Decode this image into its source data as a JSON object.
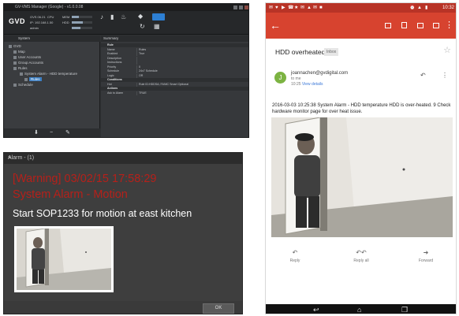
{
  "vms": {
    "title": "GV-VMS Manager (Google) - v1.0.0.08",
    "logo": "GVD",
    "stats": [
      "GVS 06.21",
      "CPU",
      "IP: 192.168.1.50",
      "MEM",
      "admin",
      "HDD"
    ],
    "left_header": "System",
    "tree": [
      "Map",
      "User Accounts",
      "Group Accounts",
      "Rules",
      "System Alarm - HDD temperature",
      "Rules",
      "Schedule"
    ],
    "right_header": "Summary",
    "props": [
      {
        "k": "Rule",
        "v": "",
        "section": true
      },
      {
        "k": "Name",
        "v": "Rules"
      },
      {
        "k": "Enabled",
        "v": "True"
      },
      {
        "k": "Description",
        "v": ""
      },
      {
        "k": "Instructions",
        "v": ""
      },
      {
        "k": "Priority",
        "v": "0"
      },
      {
        "k": "Schedule",
        "v": "24x7 Schedule"
      },
      {
        "k": "Logic",
        "v": "OR"
      },
      {
        "k": "Conditions",
        "v": "",
        "section": true
      },
      {
        "k": "Hot",
        "v": "Rule ID:HDDSA; FANIC Smart Optional"
      },
      {
        "k": "Actions",
        "v": "",
        "section": true
      },
      {
        "k": "Ask to Alarm",
        "v": "TRUE"
      }
    ]
  },
  "alarm": {
    "title": "Alarm - (1)",
    "close": "×",
    "line1": "[Warning] 03/02/15 17:58:29",
    "line2": "System Alarm - Motion",
    "line3": "Start SOP1233 for motion at east kitchen",
    "ok": "OK"
  },
  "phone": {
    "status_time": "10:32",
    "subject": "HDD overheated",
    "inbox_label": "Inbox",
    "avatar_letter": "J",
    "sender": "joannachen@gvdigital.com",
    "to": "to me",
    "time": "10:25",
    "view_details": "View details",
    "body": "2016-03-03 10:25:38 System Alarm - HDD temperature HDD is over-heated. 9 Check hardware monitor page for over heat issue.",
    "actions": [
      "Reply",
      "Reply all",
      "Forward"
    ]
  },
  "colors": {
    "accent_red": "#d7432f",
    "alarm_red": "#b5201a",
    "avatar_green": "#7cb342"
  }
}
